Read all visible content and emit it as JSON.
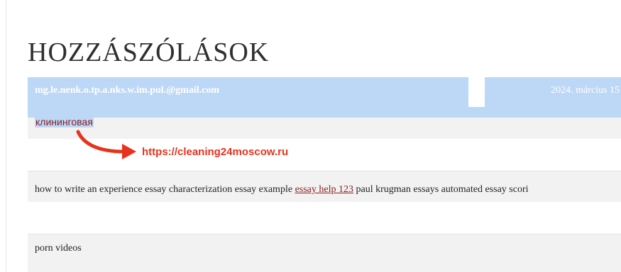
{
  "page": {
    "title": "HOZZÁSZÓLÁSOK"
  },
  "comments": [
    {
      "author_email": "mg.le.nenk.o.tp.a.nks.w.im.pul.@gmail.com",
      "date": "2024. március 15",
      "link_text": "клининговая"
    },
    {
      "text_before": "how to write an experience essay characterization essay example ",
      "link_text": "essay help 123",
      "text_after": " paul krugman essays automated essay scori"
    },
    {
      "text": "porn videos"
    }
  ],
  "annotation": {
    "url": "https://cleaning24moscow.ru",
    "color": "#e8321d"
  },
  "colors": {
    "selection": "#bcd8f6",
    "link": "#8a1d1d",
    "row_bg": "#f2f2f2"
  }
}
